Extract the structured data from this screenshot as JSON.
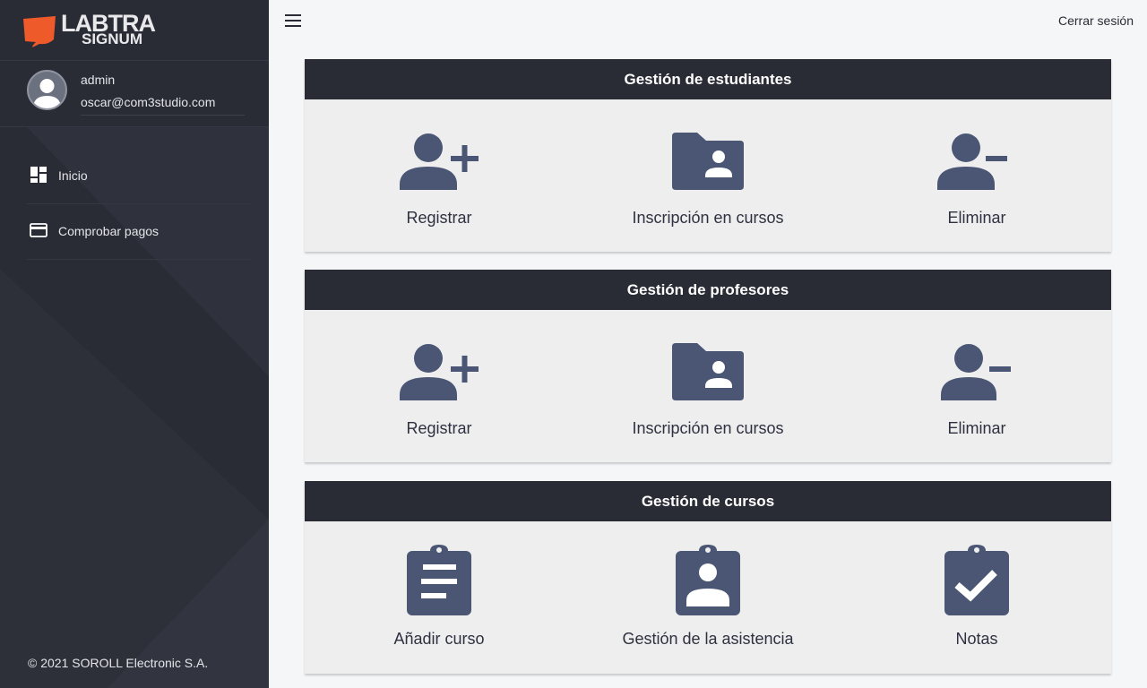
{
  "brand": {
    "line1": "LABTRA",
    "line2": "SIGNUM",
    "accent_color": "#ee5a2a"
  },
  "user": {
    "name": "admin",
    "email": "oscar@com3studio.com"
  },
  "sidebar": {
    "items": [
      {
        "label": "Inicio",
        "icon": "dashboard-icon"
      },
      {
        "label": "Comprobar pagos",
        "icon": "credit-card-icon"
      }
    ],
    "footer": "© 2021 SOROLL Electronic S.A."
  },
  "topbar": {
    "menu_icon": "hamburger-icon",
    "logout_label": "Cerrar sesión"
  },
  "sections": [
    {
      "title": "Gestión de estudiantes",
      "actions": [
        {
          "label": "Registrar",
          "icon": "person-add-icon"
        },
        {
          "label": "Inscripción en cursos",
          "icon": "folder-shared-icon"
        },
        {
          "label": "Eliminar",
          "icon": "person-remove-icon"
        }
      ]
    },
    {
      "title": "Gestión de profesores",
      "actions": [
        {
          "label": "Registrar",
          "icon": "person-add-icon"
        },
        {
          "label": "Inscripción en cursos",
          "icon": "folder-shared-icon"
        },
        {
          "label": "Eliminar",
          "icon": "person-remove-icon"
        }
      ]
    },
    {
      "title": "Gestión de cursos",
      "actions": [
        {
          "label": "Añadir curso",
          "icon": "clipboard-list-icon"
        },
        {
          "label": "Gestión de la asistencia",
          "icon": "clipboard-person-icon"
        },
        {
          "label": "Notas",
          "icon": "clipboard-check-icon"
        }
      ]
    }
  ],
  "colors": {
    "sidebar_bg": "#2a2c35",
    "icon": "#4a5673",
    "card_bg": "#eeeeef"
  }
}
